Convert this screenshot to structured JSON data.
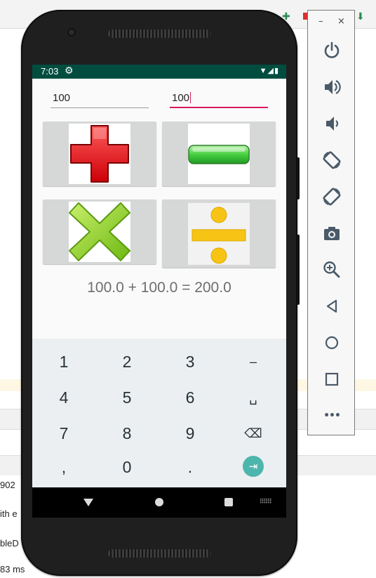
{
  "ide": {
    "log_lines": [
      "902",
      "ith e",
      "bleD",
      "83 ms"
    ]
  },
  "statusbar": {
    "time": "7:03",
    "settings_icon": "gear-icon",
    "right_icons": "▼◢▮"
  },
  "inputs": {
    "first_value": "100",
    "second_value": "100"
  },
  "operations": [
    {
      "name": "add",
      "icon": "plus-icon",
      "color": "#e8101a"
    },
    {
      "name": "subtract",
      "icon": "minus-icon",
      "color": "#3ec83e"
    },
    {
      "name": "multiply",
      "icon": "multiply-icon",
      "color": "#8ccf22"
    },
    {
      "name": "divide",
      "icon": "divide-icon",
      "color": "#f7c415"
    }
  ],
  "result_text": "100.0 + 100.0 = 200.0",
  "keyboard": {
    "rows": [
      [
        "1",
        "2",
        "3",
        "–"
      ],
      [
        "4",
        "5",
        "6",
        "␣"
      ],
      [
        "7",
        "8",
        "9",
        "⌫"
      ],
      [
        ",",
        "0",
        ".",
        "⇥"
      ]
    ],
    "enter_color": "#4db6ac"
  },
  "navbar": {
    "back": "back-icon",
    "home": "home-icon",
    "recents": "recents-icon",
    "keyboard": "keyboard-switch-icon",
    "keyboard_glyph": "⠿⠿⠿"
  },
  "toolbar": {
    "minimize": "–",
    "close": "×",
    "buttons": [
      "power",
      "volume-up",
      "volume-down",
      "rotate-left",
      "rotate-right",
      "screenshot",
      "zoom",
      "back",
      "home",
      "overview",
      "more"
    ],
    "more_glyph": "•••",
    "accent": "#4a5a68"
  }
}
